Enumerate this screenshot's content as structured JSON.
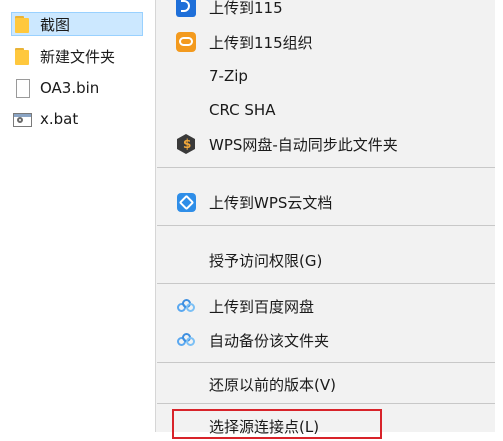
{
  "files": [
    {
      "name": "截图",
      "type": "folder",
      "selected": true
    },
    {
      "name": "新建文件夹",
      "type": "folder",
      "selected": false
    },
    {
      "name": "OA3.bin",
      "type": "file",
      "selected": false
    },
    {
      "name": "x.bat",
      "type": "bat",
      "selected": false
    }
  ],
  "menu": {
    "items": [
      {
        "label": "上传到115",
        "icon": "cloud-115-icon"
      },
      {
        "label": "上传到115组织",
        "icon": "cloud-115-org-icon"
      },
      {
        "label": "7-Zip",
        "icon": ""
      },
      {
        "label": "CRC SHA",
        "icon": ""
      },
      {
        "label": "WPS网盘-自动同步此文件夹",
        "icon": "wps-disk-icon"
      },
      {
        "label": "上传到WPS云文档",
        "icon": "wps-cloud-icon"
      },
      {
        "label": "授予访问权限(G)",
        "icon": ""
      },
      {
        "label": "上传到百度网盘",
        "icon": "baidu-netdisk-icon"
      },
      {
        "label": "自动备份该文件夹",
        "icon": "baidu-netdisk-icon"
      },
      {
        "label": "还原以前的版本(V)",
        "icon": ""
      },
      {
        "label": "选择源连接点(L)",
        "icon": ""
      }
    ]
  },
  "colors": {
    "selection_bg": "#cce8ff",
    "menu_bg": "#f2f2f2",
    "highlight_border": "#d8232a"
  }
}
